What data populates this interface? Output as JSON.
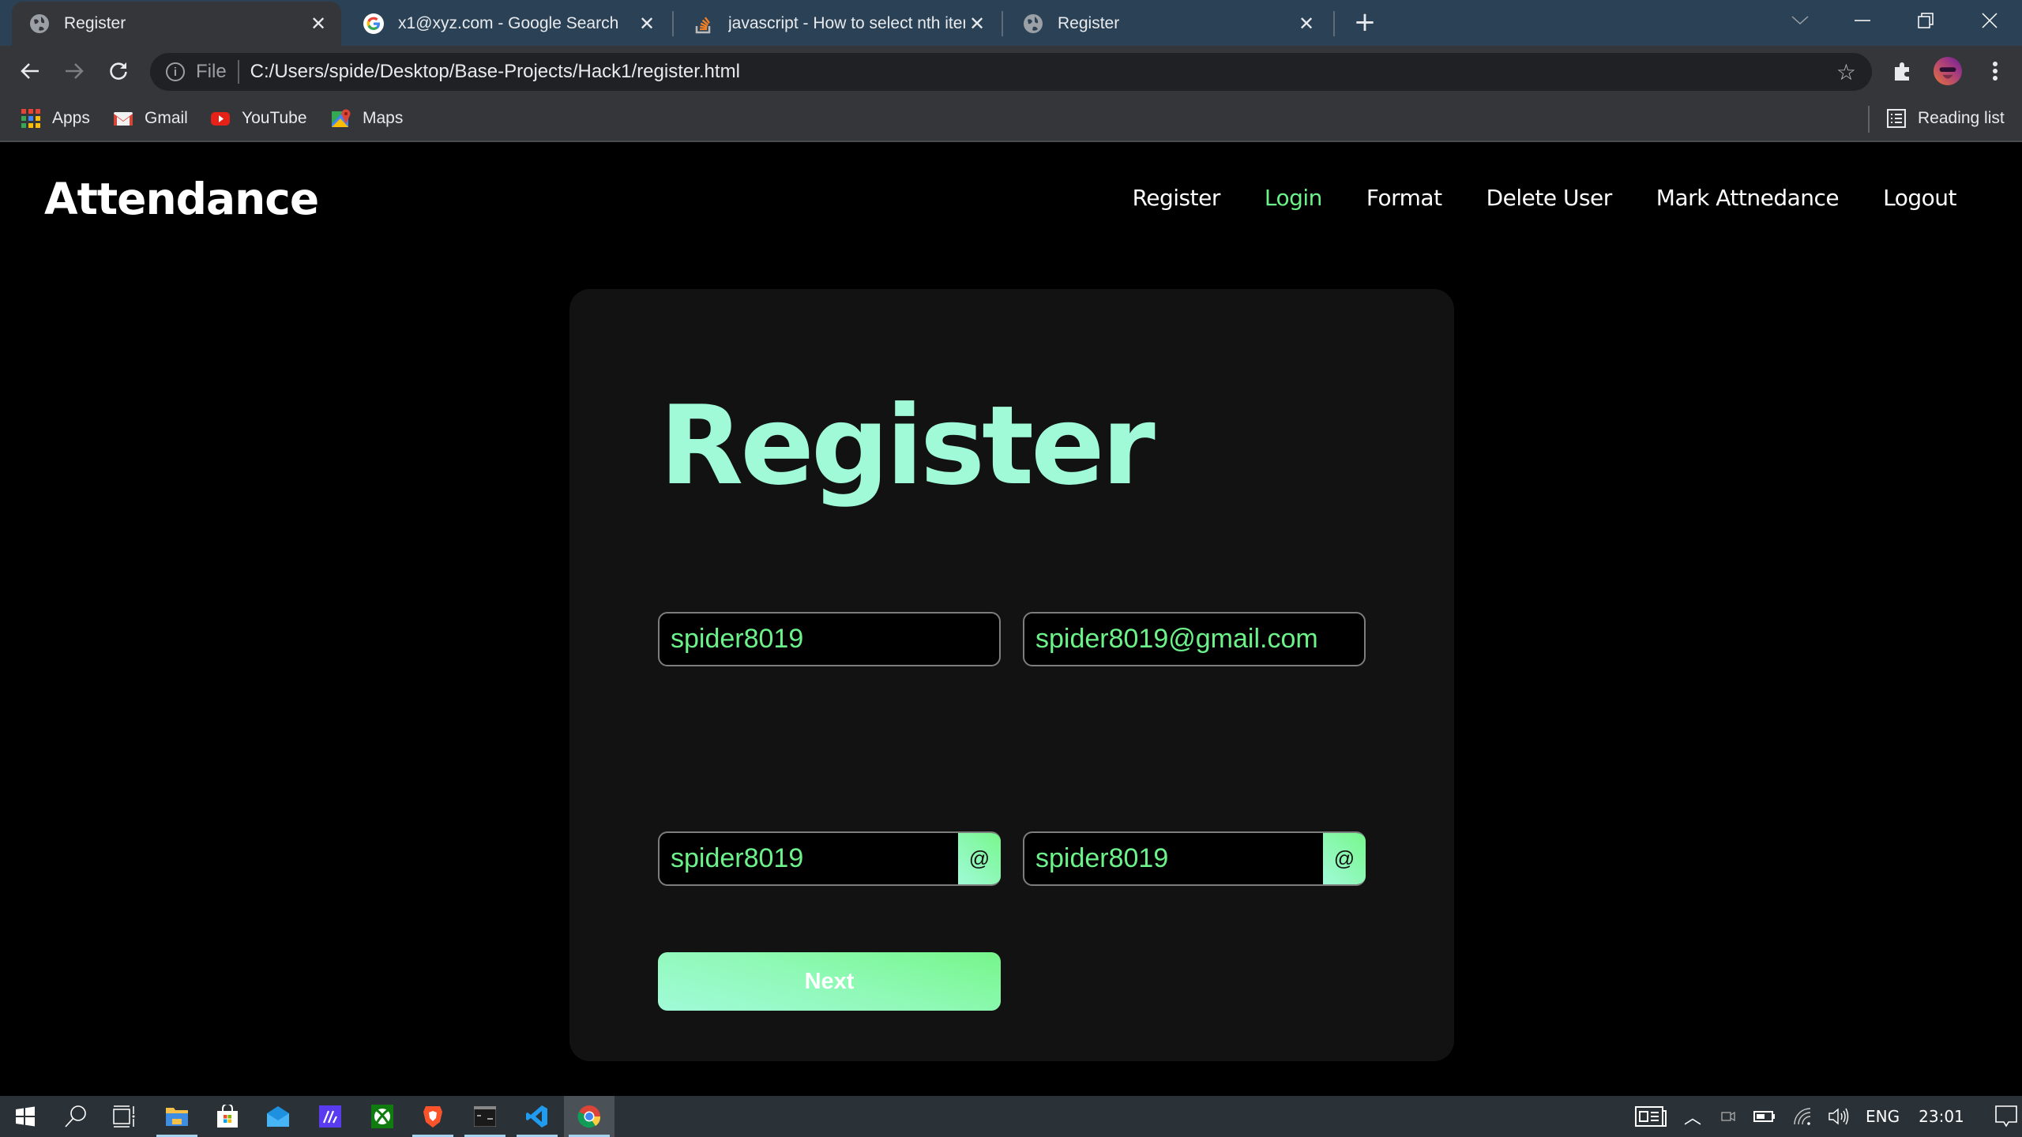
{
  "browser": {
    "tabs": [
      {
        "title": "Register",
        "icon": "globe-icon",
        "active": true
      },
      {
        "title": "x1@xyz.com - Google Search",
        "icon": "google-icon",
        "active": false
      },
      {
        "title": "javascript - How to select nth iter",
        "icon": "stackoverflow-icon",
        "active": false
      },
      {
        "title": "Register",
        "icon": "globe-icon",
        "active": false
      }
    ],
    "close_glyph": "✕",
    "new_tab_glyph": "+",
    "address": {
      "scheme_label": "File",
      "url": "C:/Users/spide/Desktop/Base-Projects/Hack1/register.html"
    },
    "bookmarks": [
      {
        "label": "Apps",
        "icon": "apps-grid-icon"
      },
      {
        "label": "Gmail",
        "icon": "gmail-icon"
      },
      {
        "label": "YouTube",
        "icon": "youtube-icon"
      },
      {
        "label": "Maps",
        "icon": "maps-icon"
      }
    ],
    "reading_list_label": "Reading list"
  },
  "page": {
    "brand": "Attendance",
    "nav": [
      {
        "label": "Register",
        "current": false
      },
      {
        "label": "Login",
        "current": true
      },
      {
        "label": "Format",
        "current": false
      },
      {
        "label": "Delete User",
        "current": false
      },
      {
        "label": "Mark Attnedance",
        "current": false
      },
      {
        "label": "Logout",
        "current": false
      }
    ],
    "form": {
      "title": "Register",
      "fields": [
        {
          "name": "username",
          "value": "spider8019"
        },
        {
          "name": "email",
          "value": "spider8019@gmail.com"
        },
        {
          "name": "password",
          "value": "spider8019",
          "append": "@"
        },
        {
          "name": "confirm-password",
          "value": "spider8019",
          "append": "@"
        }
      ],
      "submit_label": "Next"
    },
    "colors": {
      "accent_mint": "#a0fad8",
      "accent_green": "#6cf28a",
      "card_bg": "#121212"
    }
  },
  "taskbar": {
    "apps": [
      "windows-start",
      "search",
      "task-view",
      "file-explorer",
      "microsoft-store",
      "mail",
      "visual-studio",
      "xbox",
      "brave",
      "terminal",
      "vscode",
      "chrome"
    ],
    "tray": {
      "language": "ENG",
      "time": "23:01"
    }
  }
}
